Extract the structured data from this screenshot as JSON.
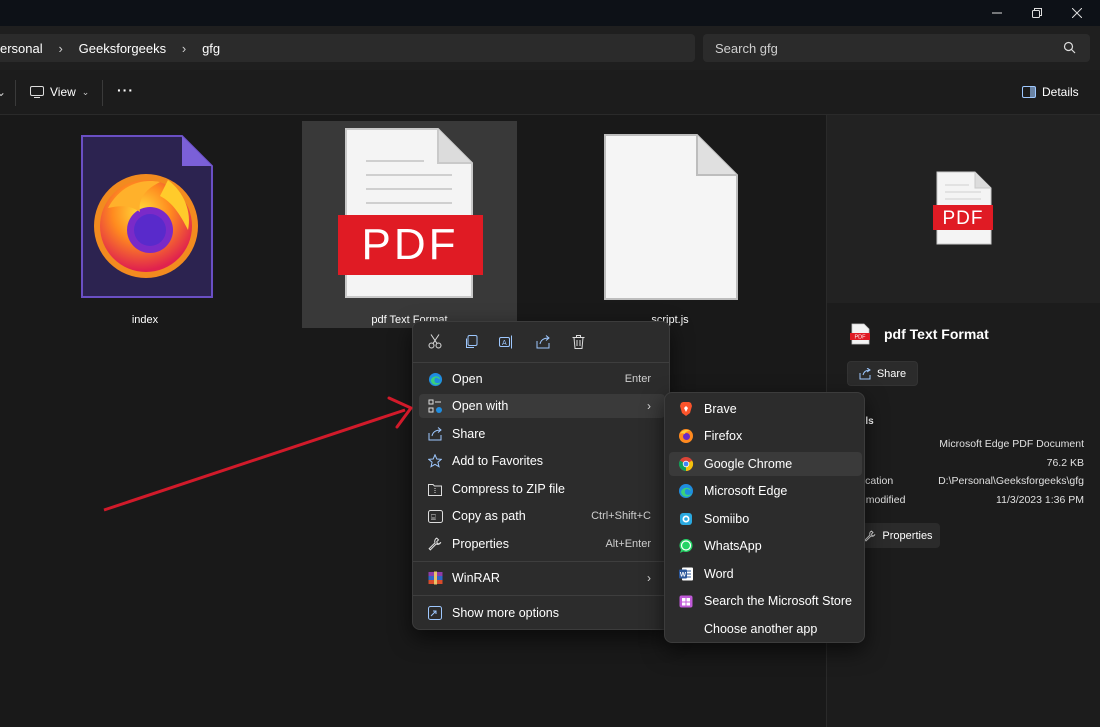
{
  "window": {
    "controls": [
      "minimize",
      "restore",
      "close"
    ]
  },
  "address_bar": {
    "crumbs": [
      "ersonal",
      "Geeksforgeeks",
      "gfg"
    ],
    "search_placeholder": "Search gfg"
  },
  "toolbar": {
    "view_label": "View",
    "more_label": "···",
    "details_label": "Details"
  },
  "files": [
    {
      "name": "index",
      "type": "firefox-html"
    },
    {
      "name": "pdf Text Format",
      "type": "pdf",
      "selected": true
    },
    {
      "name": "script.js",
      "type": "blank"
    }
  ],
  "pdf_icon_text": "PDF",
  "context_menu": {
    "quick_actions": [
      "cut-icon",
      "copy-icon",
      "rename-icon",
      "share-icon",
      "delete-icon"
    ],
    "items": [
      {
        "label": "Open",
        "shortcut": "Enter",
        "icon": "edge-icon"
      },
      {
        "label": "Open with",
        "submenu": true,
        "icon": "open-with-icon",
        "hover": true
      },
      {
        "label": "Share",
        "icon": "share-icon"
      },
      {
        "label": "Add to Favorites",
        "icon": "star-icon"
      },
      {
        "label": "Compress to ZIP file",
        "icon": "zip-icon"
      },
      {
        "label": "Copy as path",
        "shortcut": "Ctrl+Shift+C",
        "icon": "copy-path-icon"
      },
      {
        "label": "Properties",
        "shortcut": "Alt+Enter",
        "icon": "wrench-icon"
      },
      {
        "label": "WinRAR",
        "submenu": true,
        "icon": "winrar-icon"
      },
      {
        "label": "Show more options",
        "icon": "more-options-icon"
      }
    ]
  },
  "open_with_menu": {
    "items": [
      {
        "label": "Brave",
        "icon": "brave-icon"
      },
      {
        "label": "Firefox",
        "icon": "firefox-icon"
      },
      {
        "label": "Google Chrome",
        "icon": "chrome-icon",
        "hover": true
      },
      {
        "label": "Microsoft Edge",
        "icon": "edge-icon"
      },
      {
        "label": "Somiibo",
        "icon": "somiibo-icon"
      },
      {
        "label": "WhatsApp",
        "icon": "whatsapp-icon"
      },
      {
        "label": "Word",
        "icon": "word-icon"
      },
      {
        "label": "Search the Microsoft Store",
        "icon": "store-icon"
      },
      {
        "label": "Choose another app",
        "icon": ""
      }
    ]
  },
  "details_pane": {
    "file_name": "pdf Text Format",
    "share_label": "Share",
    "section_label": "ails",
    "rows": [
      {
        "key": "e",
        "value": "Microsoft Edge PDF Document"
      },
      {
        "key": "",
        "value": "76.2 KB"
      },
      {
        "key": "location",
        "value": "D:\\Personal\\Geeksforgeeks\\gfg"
      },
      {
        "key": "e modified",
        "value": "11/3/2023 1:36 PM"
      }
    ],
    "properties_label": "Properties"
  },
  "colors": {
    "pdf_red": "#e01b24",
    "annotation_arrow": "#d11a2a",
    "menu_bg": "#2c2c2c",
    "window_bg": "#191919"
  }
}
